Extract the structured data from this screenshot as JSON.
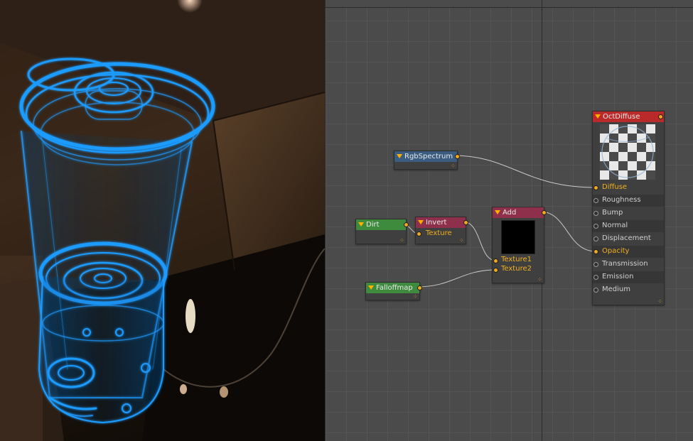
{
  "nodes": {
    "rgbspectrum": {
      "title": "RgbSpectrum"
    },
    "dirt": {
      "title": "Dirt"
    },
    "invert": {
      "title": "Invert",
      "input": "Texture"
    },
    "falloffmap": {
      "title": "Falloffmap"
    },
    "add": {
      "title": "Add",
      "inputs": [
        "Texture1",
        "Texture2"
      ]
    },
    "octdiffuse": {
      "title": "OctDiffuse",
      "pins": [
        "Diffuse",
        "Roughness",
        "Bump",
        "Normal",
        "Displacement",
        "Opacity",
        "Transmission",
        "Emission",
        "Medium"
      ]
    }
  },
  "colors": {
    "pin_active": "#f2b020",
    "wire": "#c8c8c8",
    "object_glow": "#1e9bff"
  }
}
